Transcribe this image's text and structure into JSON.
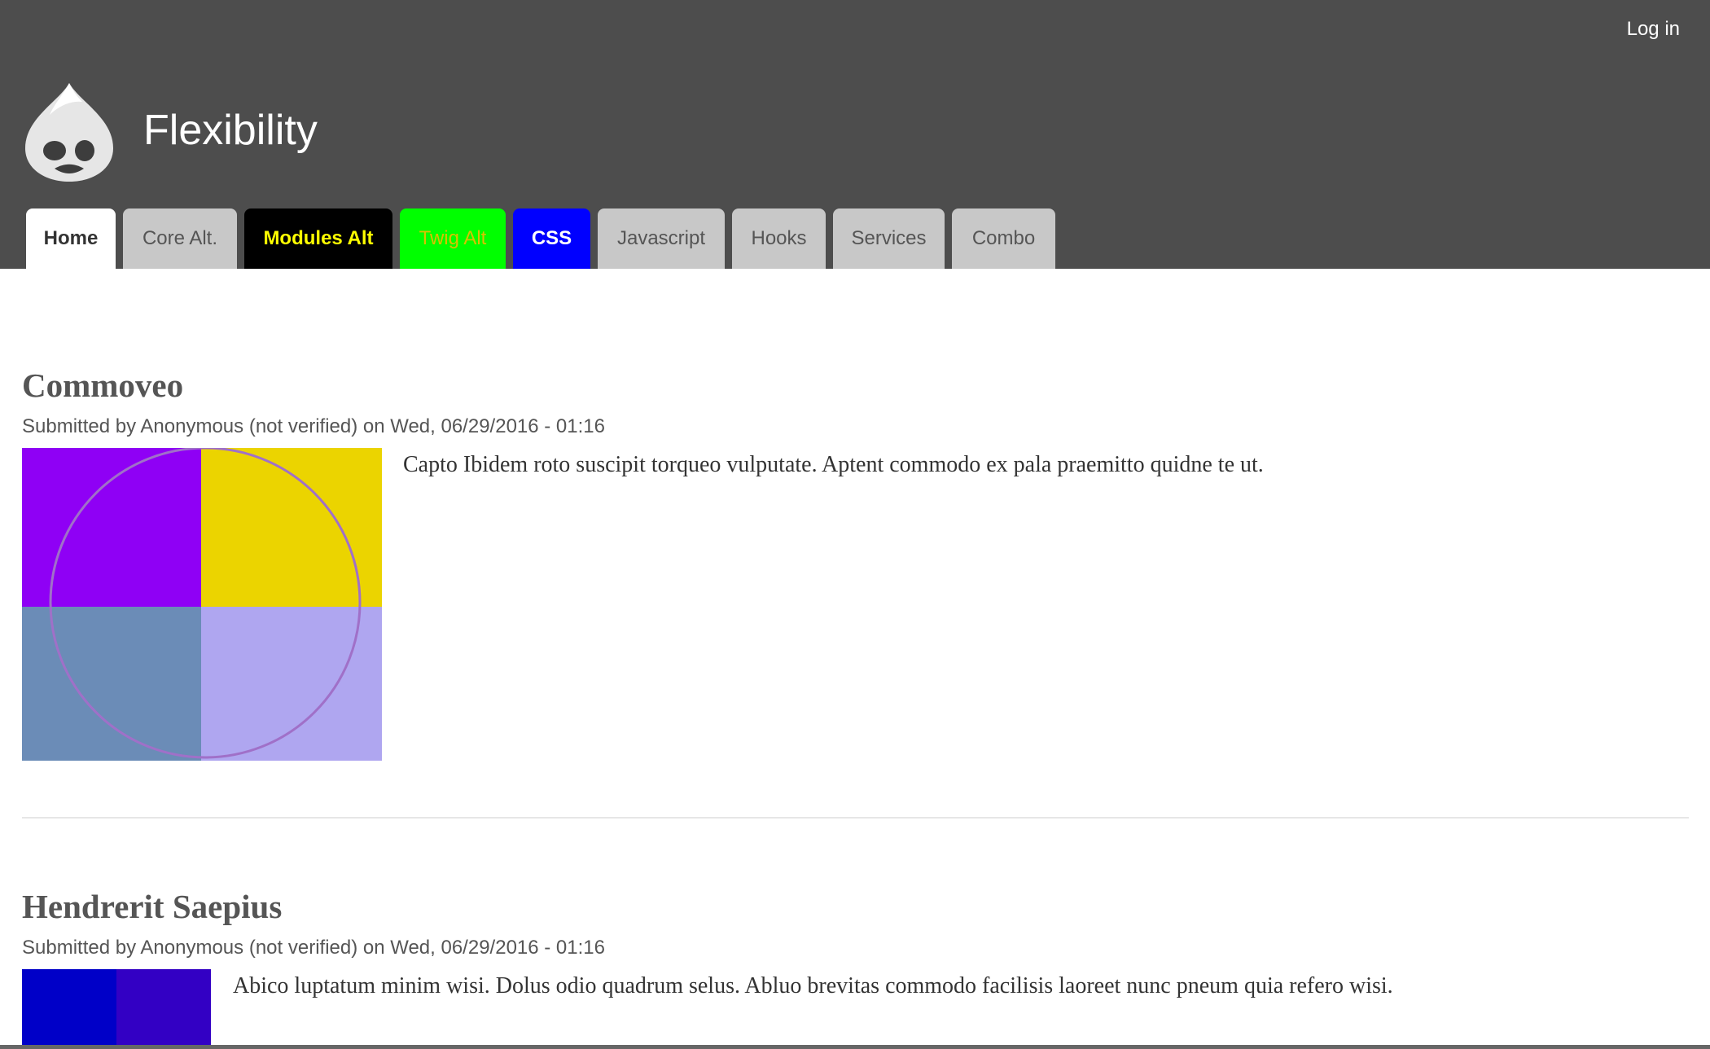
{
  "header": {
    "site_name": "Flexibility",
    "login": "Log in",
    "logo_icon": "drupal-drop-logo-icon",
    "background": "#4d4d4d"
  },
  "tabs": [
    {
      "label": "Home",
      "style": "active"
    },
    {
      "label": "Core Alt.",
      "style": "default"
    },
    {
      "label": "Modules Alt",
      "style": "black"
    },
    {
      "label": "Twig Alt",
      "style": "green"
    },
    {
      "label": "CSS",
      "style": "blue"
    },
    {
      "label": "Javascript",
      "style": "default"
    },
    {
      "label": "Hooks",
      "style": "default"
    },
    {
      "label": "Services",
      "style": "default"
    },
    {
      "label": "Combo",
      "style": "default"
    }
  ],
  "articles": [
    {
      "title": "Commoveo",
      "submitted": "Submitted by Anonymous (not verified) on Wed, 06/29/2016 - 01:16",
      "body": "Capto Ibidem roto suscipit torqueo vulputate. Aptent commodo ex pala praemitto quidne te ut.",
      "image_colors": [
        "#8f00f5",
        "#ebd400",
        "#6b8cb7",
        "#afa6f0"
      ]
    },
    {
      "title": "Hendrerit Saepius",
      "submitted": "Submitted by Anonymous (not verified) on Wed, 06/29/2016 - 01:16",
      "body": "Abico luptatum minim wisi. Dolus odio quadrum selus. Abluo brevitas commodo facilisis laoreet nunc pneum quia refero wisi.",
      "image_colors": [
        "#0000c8",
        "#3300c4"
      ]
    }
  ]
}
